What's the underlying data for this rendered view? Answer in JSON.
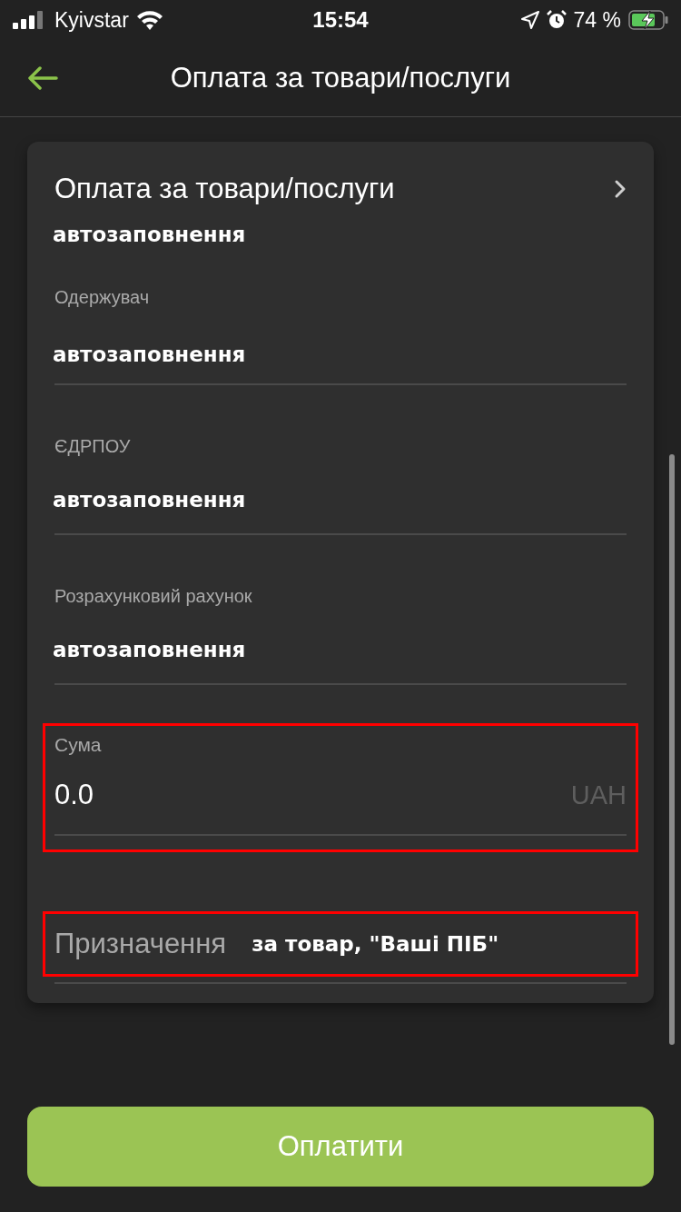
{
  "status_bar": {
    "carrier": "Kyivstar",
    "time": "15:54",
    "battery": "74 %"
  },
  "header": {
    "title": "Оплата за товари/послуги"
  },
  "card": {
    "title": "Оплата за товари/послуги",
    "value": "автозаповнення",
    "fields": [
      {
        "kind": "text",
        "label": "Одержувач",
        "value": "автозаповнення",
        "highlighted": false
      },
      {
        "kind": "text",
        "label": "ЄДРПОУ",
        "value": "автозаповнення",
        "highlighted": false
      },
      {
        "kind": "text",
        "label": "Розрахунковий рахунок",
        "value": "автозаповнення",
        "highlighted": false
      },
      {
        "kind": "amount",
        "label": "Сума",
        "value": "0.0",
        "currency": "UAH",
        "highlighted": true
      },
      {
        "kind": "inline",
        "label": "Призначення",
        "value": "за товар, \"Ваші ПІБ\"",
        "highlighted": true
      }
    ]
  },
  "pay_button": {
    "label": "Оплатити"
  }
}
